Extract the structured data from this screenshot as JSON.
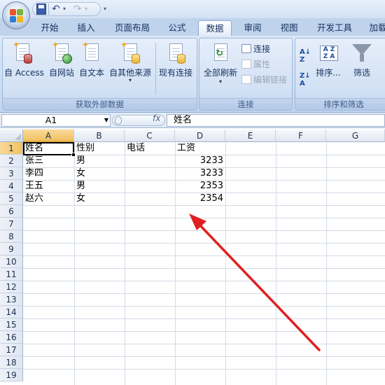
{
  "tabs": [
    "开始",
    "插入",
    "页面布局",
    "公式",
    "数据",
    "审阅",
    "视图",
    "开发工具",
    "加载"
  ],
  "active_tab": "数据",
  "ribbon": {
    "get_external_data": {
      "label": "获取外部数据",
      "buttons": [
        "自 Access",
        "自网站",
        "自文本",
        "自其他来源",
        "现有连接"
      ]
    },
    "connections": {
      "label": "连接",
      "refresh_all": "全部刷新",
      "small_buttons": [
        "连接",
        "属性",
        "编辑链接"
      ]
    },
    "sort_filter": {
      "label": "排序和筛选",
      "sort": "排序...",
      "filter": "筛选"
    }
  },
  "formula_bar": {
    "name_box": "A1",
    "fx": "fx",
    "content": "姓名"
  },
  "columns": [
    "A",
    "B",
    "C",
    "D",
    "E",
    "F",
    "G"
  ],
  "rows": [
    "1",
    "2",
    "3",
    "4",
    "5",
    "6",
    "7",
    "8",
    "9",
    "10",
    "11",
    "12",
    "13",
    "14",
    "15",
    "16",
    "17",
    "18",
    "19"
  ],
  "cells": {
    "headers": [
      "姓名",
      "性别",
      "电话",
      "工资"
    ],
    "records": [
      {
        "name": "张三",
        "gender": "男",
        "salary": "3233"
      },
      {
        "name": "李四",
        "gender": "女",
        "salary": "3233"
      },
      {
        "name": "王五",
        "gender": "男",
        "salary": "2353"
      },
      {
        "name": "赵六",
        "gender": "女",
        "salary": "2354"
      }
    ]
  },
  "annotation": {
    "color": "#e02020"
  },
  "colors": {
    "ribbon_bg": "#cfdff2",
    "selected_header": "#f1c15f",
    "tab_text": "#15305e"
  }
}
